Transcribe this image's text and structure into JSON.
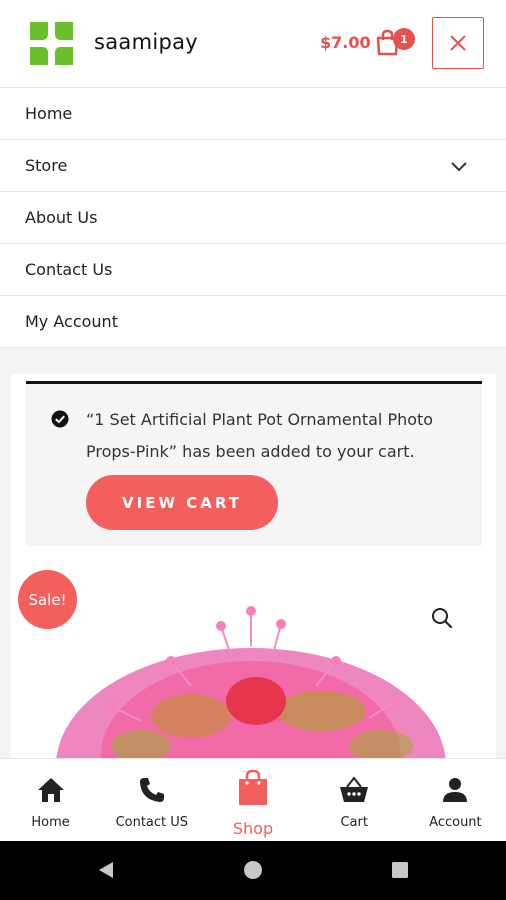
{
  "header": {
    "brand": "saamipay",
    "cart_total": "$7.00",
    "cart_count": "1"
  },
  "menu": {
    "items": [
      {
        "label": "Home",
        "has_submenu": false
      },
      {
        "label": "Store",
        "has_submenu": true
      },
      {
        "label": "About Us",
        "has_submenu": false
      },
      {
        "label": "Contact Us",
        "has_submenu": false
      },
      {
        "label": "My Account",
        "has_submenu": false
      }
    ]
  },
  "notice": {
    "message": "“1 Set Artificial Plant Pot Ornamental Photo Props-Pink” has been added to your cart.",
    "button_label": "VIEW CART"
  },
  "product": {
    "sale_label": "Sale!"
  },
  "bottom_nav": {
    "items": [
      {
        "label": "Home",
        "icon": "home-icon"
      },
      {
        "label": "Contact US",
        "icon": "phone-icon"
      },
      {
        "label": "Shop",
        "icon": "shopping-bag-icon",
        "active": true
      },
      {
        "label": "Cart",
        "icon": "basket-icon"
      },
      {
        "label": "Account",
        "icon": "person-icon"
      }
    ]
  },
  "colors": {
    "accent": "#f25f5c",
    "logo_green": "#6bbf2a",
    "text": "#222222"
  }
}
